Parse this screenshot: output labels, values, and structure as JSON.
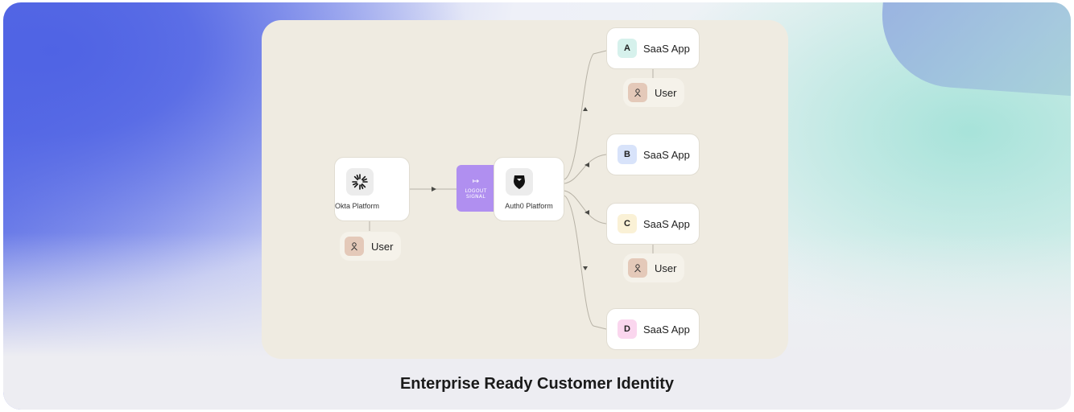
{
  "diagram": {
    "okta_platform": "Okta Platform",
    "auth0_platform": "Auth0 Platform",
    "logout_signal": "LOGOUT\nSIGNAL",
    "user_label": "User",
    "apps": [
      {
        "letter": "A",
        "label": "SaaS App",
        "color": "#d6f1ec"
      },
      {
        "letter": "B",
        "label": "SaaS App",
        "color": "#d8e3fa"
      },
      {
        "letter": "C",
        "label": "SaaS App",
        "color": "#faf1d6"
      },
      {
        "letter": "D",
        "label": "SaaS App",
        "color": "#fad6ee"
      }
    ],
    "users": [
      "User",
      "User",
      "User"
    ]
  },
  "caption": "Enterprise Ready Customer Identity",
  "colors": {
    "canvas": "#efebe1",
    "signal": "#b08ff0",
    "avatar": "#e4c9b9"
  }
}
